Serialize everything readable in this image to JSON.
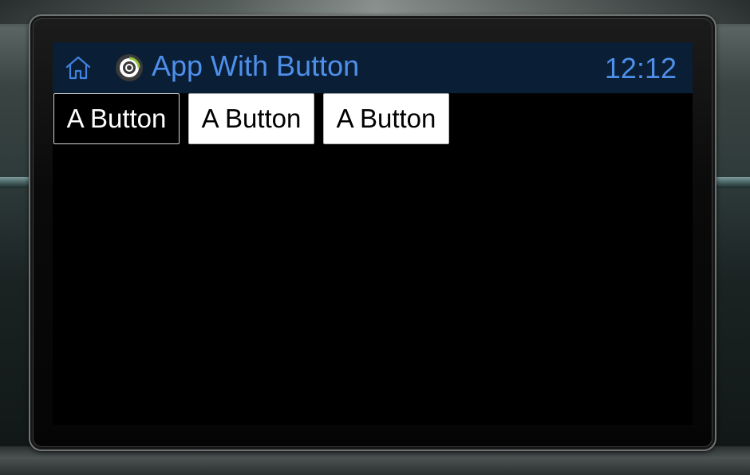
{
  "header": {
    "app_title": "App With Button",
    "clock": "12:12",
    "home_icon": "home-icon",
    "app_icon": "app-logo-icon",
    "title_color": "#4e8fea",
    "background_color": "#0a1e35"
  },
  "buttons": [
    {
      "label": "A Button",
      "state": "focused"
    },
    {
      "label": "A Button",
      "state": "normal"
    },
    {
      "label": "A Button",
      "state": "normal"
    }
  ],
  "colors": {
    "screen_background": "#000000",
    "button_background": "#ffffff",
    "button_text": "#000000",
    "focused_button_text": "#ffffff"
  }
}
